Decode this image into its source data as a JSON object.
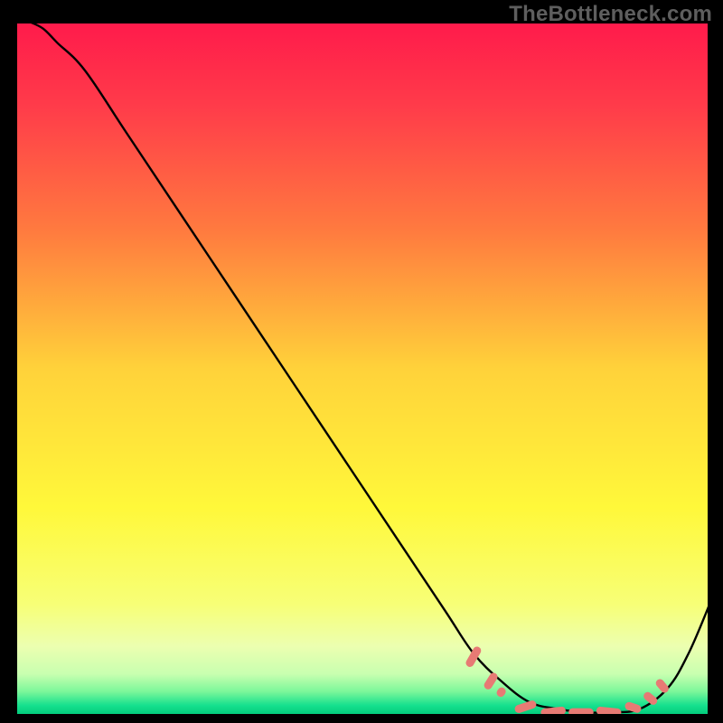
{
  "watermark": "TheBottleneck.com",
  "chart_data": {
    "type": "line",
    "title": "",
    "xlabel": "",
    "ylabel": "",
    "xlim": [
      0,
      100
    ],
    "ylim": [
      0,
      100
    ],
    "grid": false,
    "background_gradient": {
      "stops": [
        {
          "offset": 0.0,
          "color": "#ff1a4b"
        },
        {
          "offset": 0.12,
          "color": "#ff3b4a"
        },
        {
          "offset": 0.3,
          "color": "#ff7a3f"
        },
        {
          "offset": 0.5,
          "color": "#ffd23a"
        },
        {
          "offset": 0.7,
          "color": "#fff83a"
        },
        {
          "offset": 0.84,
          "color": "#f7ff77"
        },
        {
          "offset": 0.9,
          "color": "#ecffb0"
        },
        {
          "offset": 0.94,
          "color": "#c8ffb0"
        },
        {
          "offset": 0.965,
          "color": "#7cf79a"
        },
        {
          "offset": 0.985,
          "color": "#15e08e"
        },
        {
          "offset": 1.0,
          "color": "#00c879"
        }
      ]
    },
    "series": [
      {
        "name": "bottleneck-curve",
        "color": "#000000",
        "x": [
          2,
          4,
          6,
          10,
          16,
          24,
          32,
          40,
          48,
          56,
          62,
          66,
          70,
          74,
          78,
          82,
          86,
          90,
          94,
          97,
          100
        ],
        "y": [
          100,
          99,
          97,
          93,
          84,
          72,
          60,
          48,
          36,
          24,
          15,
          9,
          5,
          2,
          1,
          0.5,
          0.5,
          1,
          4,
          9,
          16
        ]
      }
    ],
    "markers": {
      "name": "highlight-dashes",
      "color": "#e77a74",
      "items": [
        {
          "x": 66.0,
          "y": 8.5,
          "len": 3.2,
          "angle": -60
        },
        {
          "x": 68.5,
          "y": 5.0,
          "len": 2.6,
          "angle": -58
        },
        {
          "x": 70.0,
          "y": 3.4,
          "len": 1.4,
          "angle": -55
        },
        {
          "x": 73.5,
          "y": 1.3,
          "len": 3.2,
          "angle": -18
        },
        {
          "x": 77.5,
          "y": 0.6,
          "len": 3.6,
          "angle": -6
        },
        {
          "x": 81.5,
          "y": 0.5,
          "len": 3.6,
          "angle": 0
        },
        {
          "x": 85.5,
          "y": 0.6,
          "len": 3.6,
          "angle": 6
        },
        {
          "x": 89.0,
          "y": 1.2,
          "len": 2.4,
          "angle": 18
        },
        {
          "x": 91.5,
          "y": 2.5,
          "len": 2.2,
          "angle": 40
        },
        {
          "x": 93.2,
          "y": 4.3,
          "len": 2.2,
          "angle": 50
        }
      ]
    }
  }
}
